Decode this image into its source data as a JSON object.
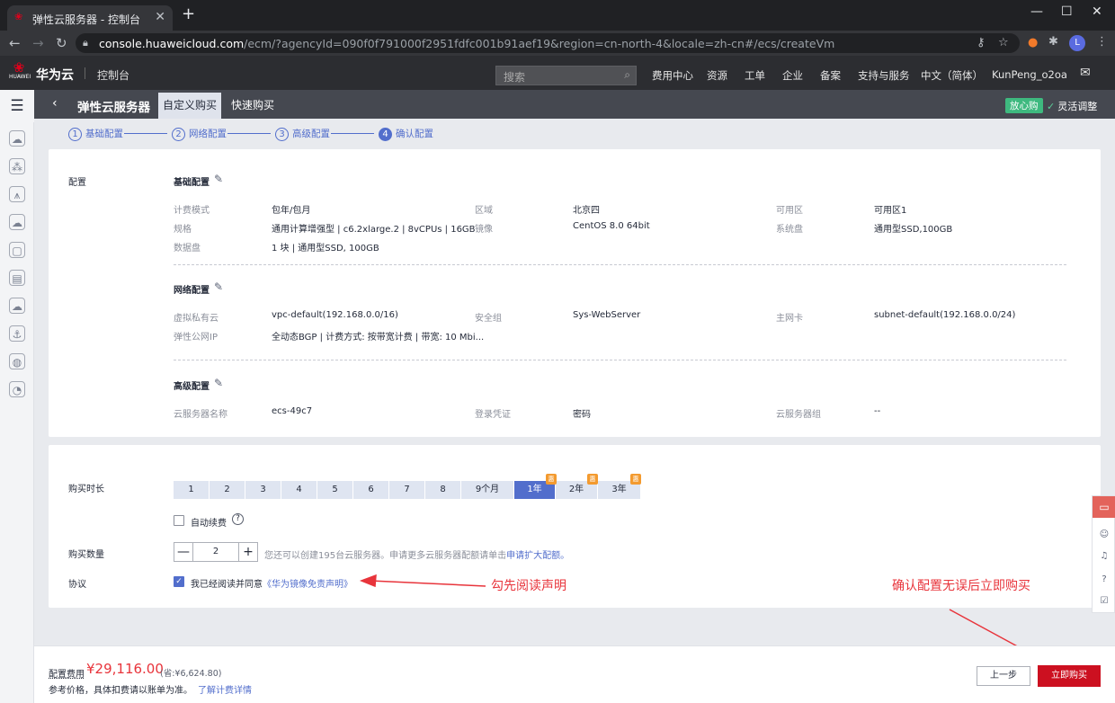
{
  "browser": {
    "tab_title": "弹性云服务器 - 控制台",
    "tab_close": "✕",
    "new_tab": "+",
    "url_host": "console.huaweicloud.com",
    "url_path": "/ecm/?agencyId=090f0f791000f2951fdfc001b91aef19&region=cn-north-4&locale=zh-cn#/ecs/createVm",
    "profile_initial": "L",
    "window_controls": [
      "—",
      "☐",
      "✕"
    ]
  },
  "console_header": {
    "brand_logo_text": "HUAWEI",
    "brand_name": "华为云",
    "console_label": "控制台",
    "search_placeholder": "搜索",
    "nav_links": [
      "费用中心",
      "资源",
      "工单",
      "企业",
      "备案",
      "支持与服务",
      "中文（简体）",
      "KunPeng_o2oa"
    ]
  },
  "service_bar": {
    "title": "弹性云服务器",
    "tabs": [
      "自定义购买",
      "快速购买"
    ],
    "active_tab": "自定义购买",
    "badge": "放心购",
    "flexible_adjust": "灵活调整"
  },
  "stepper": {
    "steps": [
      {
        "num": "1",
        "label": "基础配置"
      },
      {
        "num": "2",
        "label": "网络配置"
      },
      {
        "num": "3",
        "label": "高级配置"
      },
      {
        "num": "4",
        "label": "确认配置"
      }
    ],
    "active_step": 4
  },
  "config": {
    "section_label": "配置",
    "basic": {
      "title": "基础配置",
      "rows": [
        [
          {
            "label": "计费模式",
            "value": "包年/包月"
          },
          {
            "label": "区域",
            "value": "北京四"
          },
          {
            "label": "可用区",
            "value": "可用区1"
          }
        ],
        [
          {
            "label": "规格",
            "value": "通用计算增强型 | c6.2xlarge.2 | 8vCPUs | 16GB"
          },
          {
            "label": "镜像",
            "value": "CentOS 8.0 64bit"
          },
          {
            "label": "系统盘",
            "value": "通用型SSD,100GB"
          }
        ],
        [
          {
            "label": "数据盘",
            "value": "1 块 | 通用型SSD, 100GB"
          }
        ]
      ]
    },
    "network": {
      "title": "网络配置",
      "rows": [
        [
          {
            "label": "虚拟私有云",
            "value": "vpc-default(192.168.0.0/16)"
          },
          {
            "label": "安全组",
            "value": "Sys-WebServer"
          },
          {
            "label": "主网卡",
            "value": "subnet-default(192.168.0.0/24)"
          }
        ],
        [
          {
            "label": "弹性公网IP",
            "value": "全动态BGP | 计费方式: 按带宽计费 | 带宽: 10 Mbi..."
          }
        ]
      ]
    },
    "advanced": {
      "title": "高级配置",
      "rows": [
        [
          {
            "label": "云服务器名称",
            "value": "ecs-49c7"
          },
          {
            "label": "登录凭证",
            "value": "密码"
          },
          {
            "label": "云服务器组",
            "value": "--"
          }
        ]
      ]
    }
  },
  "purchase": {
    "duration_label": "购买时长",
    "durations": [
      "1",
      "2",
      "3",
      "4",
      "5",
      "6",
      "7",
      "8",
      "9个月",
      "1年",
      "2年",
      "3年"
    ],
    "selected_duration": "1年",
    "discount_badge": "惠",
    "auto_renew_label": "自动续费",
    "auto_renew_checked": false,
    "help_icon": "?",
    "quantity_label": "购买数量",
    "quantity": "2",
    "quantity_minus": "—",
    "quantity_plus": "+",
    "quota_note": "您还可以创建195台云服务器。申请更多云服务器配额请单击",
    "quota_link": "申请扩大配额。",
    "agreement_label": "协议",
    "agreement_checked": true,
    "agreement_text": "我已经阅读并同意",
    "agreement_link": "《华为镜像免责声明》"
  },
  "annotations": {
    "check_note": "勾先阅读声明",
    "buy_note": "确认配置无误后立即购买",
    "color": "#e8343b"
  },
  "footer": {
    "fee_label": "配置费用",
    "fee_amount": "¥29,116.00",
    "fee_saving": "(省:¥6,624.80)",
    "note": "参考价格，具体扣费请以账单为准。",
    "pricing_link": "了解计费详情",
    "prev_button": "上一步",
    "buy_button": "立即购买"
  },
  "colors": {
    "accent": "#526ecc",
    "buy_red": "#cc1020",
    "price_red": "#e8343b",
    "header_dark": "#2c2d31",
    "service_bar": "#454850"
  }
}
